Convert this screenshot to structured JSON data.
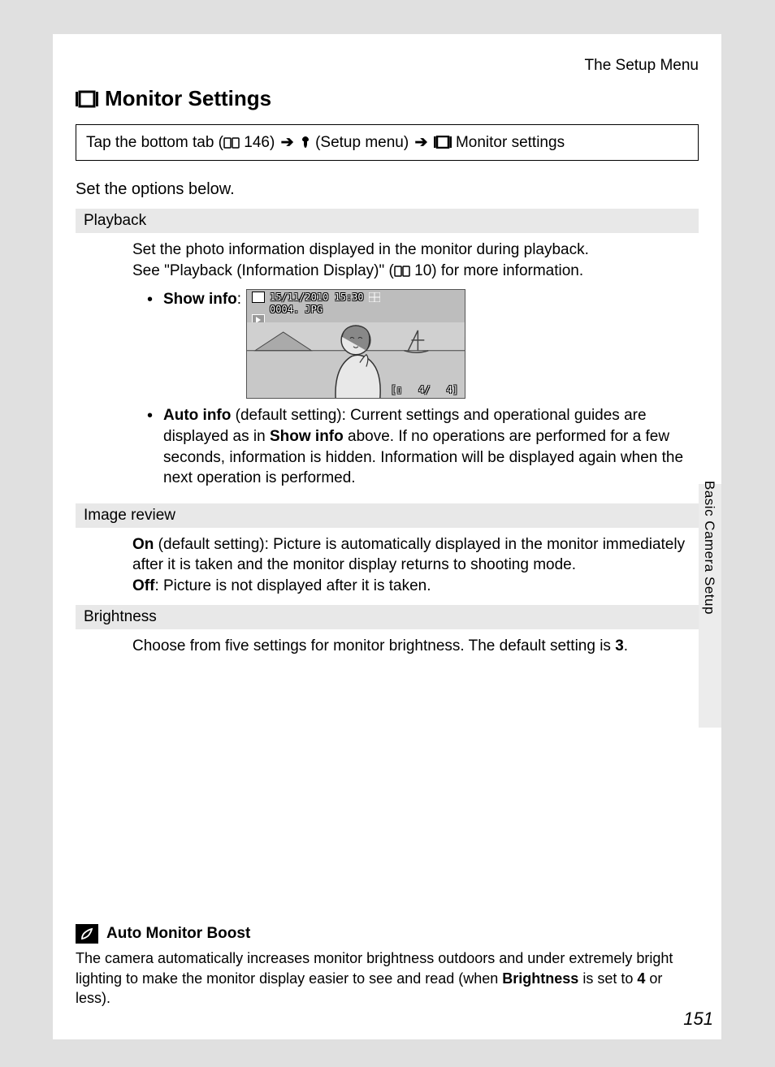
{
  "header": {
    "right": "The Setup Menu"
  },
  "title": "Monitor Settings",
  "breadcrumb": {
    "prefix": "Tap the bottom tab (",
    "pageref1": "146",
    "seg1": ") ",
    "setup_label": " (Setup menu) ",
    "monitor_label": " Monitor settings"
  },
  "intro": "Set the options below.",
  "sections": {
    "playback": {
      "header": "Playback",
      "line1": "Set the photo information displayed in the monitor during playback.",
      "line2_pre": "See \"Playback (Information Display)\" (",
      "line2_ref": "10",
      "line2_post": ") for more information.",
      "show_info_label": "Show info",
      "auto_info_label": "Auto info",
      "auto_info_default": " (default setting): Current settings and operational guides are displayed as in ",
      "auto_info_mid": "Show info",
      "auto_info_rest": " above. If no operations are performed for a few seconds, information is hidden. Information will be displayed again when the next operation is performed."
    },
    "image_review": {
      "header": "Image review",
      "on_label": "On",
      "on_text": " (default setting): Picture is automatically displayed in the monitor immediately after it is taken and the monitor display returns to shooting mode.",
      "off_label": "Off",
      "off_text": ": Picture is not displayed after it is taken."
    },
    "brightness": {
      "header": "Brightness",
      "text_pre": "Choose from five settings for monitor brightness. The default setting is ",
      "default_value": "3",
      "text_post": "."
    }
  },
  "preview": {
    "datetime": "15/11/2010 15:30",
    "filename": "0004. JPG",
    "counter1": "4/",
    "counter2": "4]",
    "battery": "[▯"
  },
  "note": {
    "title": "Auto Monitor Boost",
    "body_pre": "The camera automatically increases monitor brightness outdoors and under extremely bright lighting to make the monitor display easier to see and read (when ",
    "body_bold1": "Brightness",
    "body_mid": " is set to ",
    "body_bold2": "4",
    "body_post": " or less)."
  },
  "side_label": "Basic Camera Setup",
  "page_number": "151"
}
